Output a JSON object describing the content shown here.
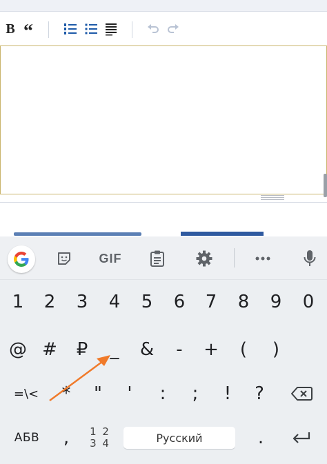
{
  "editor": {
    "toolbar": {
      "bold_label": "B",
      "quote_label": "“"
    }
  },
  "keyboard": {
    "suggestion_bar": {
      "google_letter": "G",
      "gif_label": "GIF",
      "items": [
        "google-icon",
        "sticker-icon",
        "gif-icon",
        "clipboard-icon",
        "settings-icon",
        "more-icon",
        "mic-icon"
      ]
    },
    "row1": [
      "1",
      "2",
      "3",
      "4",
      "5",
      "6",
      "7",
      "8",
      "9",
      "0"
    ],
    "row2": [
      "@",
      "#",
      "₽",
      "_",
      "&",
      "-",
      "+",
      "(",
      ")"
    ],
    "row3": [
      "=\\<",
      "*",
      "\"",
      "'",
      ":",
      ";",
      "!",
      "?"
    ],
    "row4": {
      "abc_label": "АБВ",
      "comma": ",",
      "num_top": "1 2",
      "num_bottom": "3 4",
      "space_label": "Русский",
      "period": ".",
      "enter_icon": "enter-icon"
    },
    "backspace_icon": "backspace-icon"
  },
  "annotation": {
    "arrow_color": "#f07a2a",
    "target_key": "_"
  },
  "colors": {
    "google_blue": "#4285F4",
    "google_red": "#EA4335",
    "google_yellow": "#FBBC05",
    "google_green": "#34A853",
    "keyboard_bg": "#eceff2",
    "editor_border": "#c9b46a"
  }
}
